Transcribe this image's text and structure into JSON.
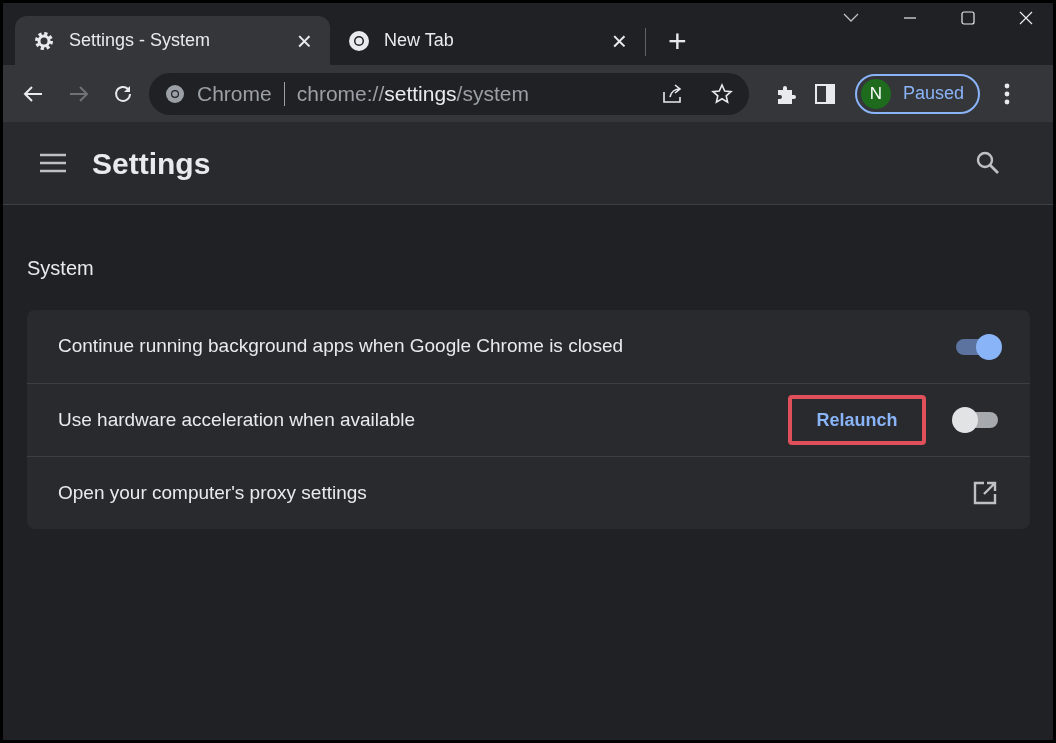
{
  "tabs": [
    {
      "title": "Settings - System",
      "kind": "settings",
      "selected": true,
      "close": "×"
    },
    {
      "title": "New Tab",
      "kind": "newtab",
      "selected": false,
      "close": "×"
    }
  ],
  "new_tab": "+",
  "toolbar": {
    "forward_disabled": true,
    "site_label": "Chrome",
    "url": "chrome://**settings**/system",
    "profile": {
      "initial": "N",
      "status": "Paused"
    }
  },
  "header": {
    "title": "Settings"
  },
  "section": {
    "title": "System",
    "rows": [
      {
        "kind": "toggle",
        "label": "Continue running background apps when Google Chrome is closed",
        "on": true
      },
      {
        "kind": "toggle",
        "label": "Use hardware acceleration when available",
        "on": false,
        "button": {
          "label": "Relaunch",
          "highlighted": true
        }
      },
      {
        "kind": "link",
        "label": "Open your computer's proxy settings"
      }
    ]
  }
}
